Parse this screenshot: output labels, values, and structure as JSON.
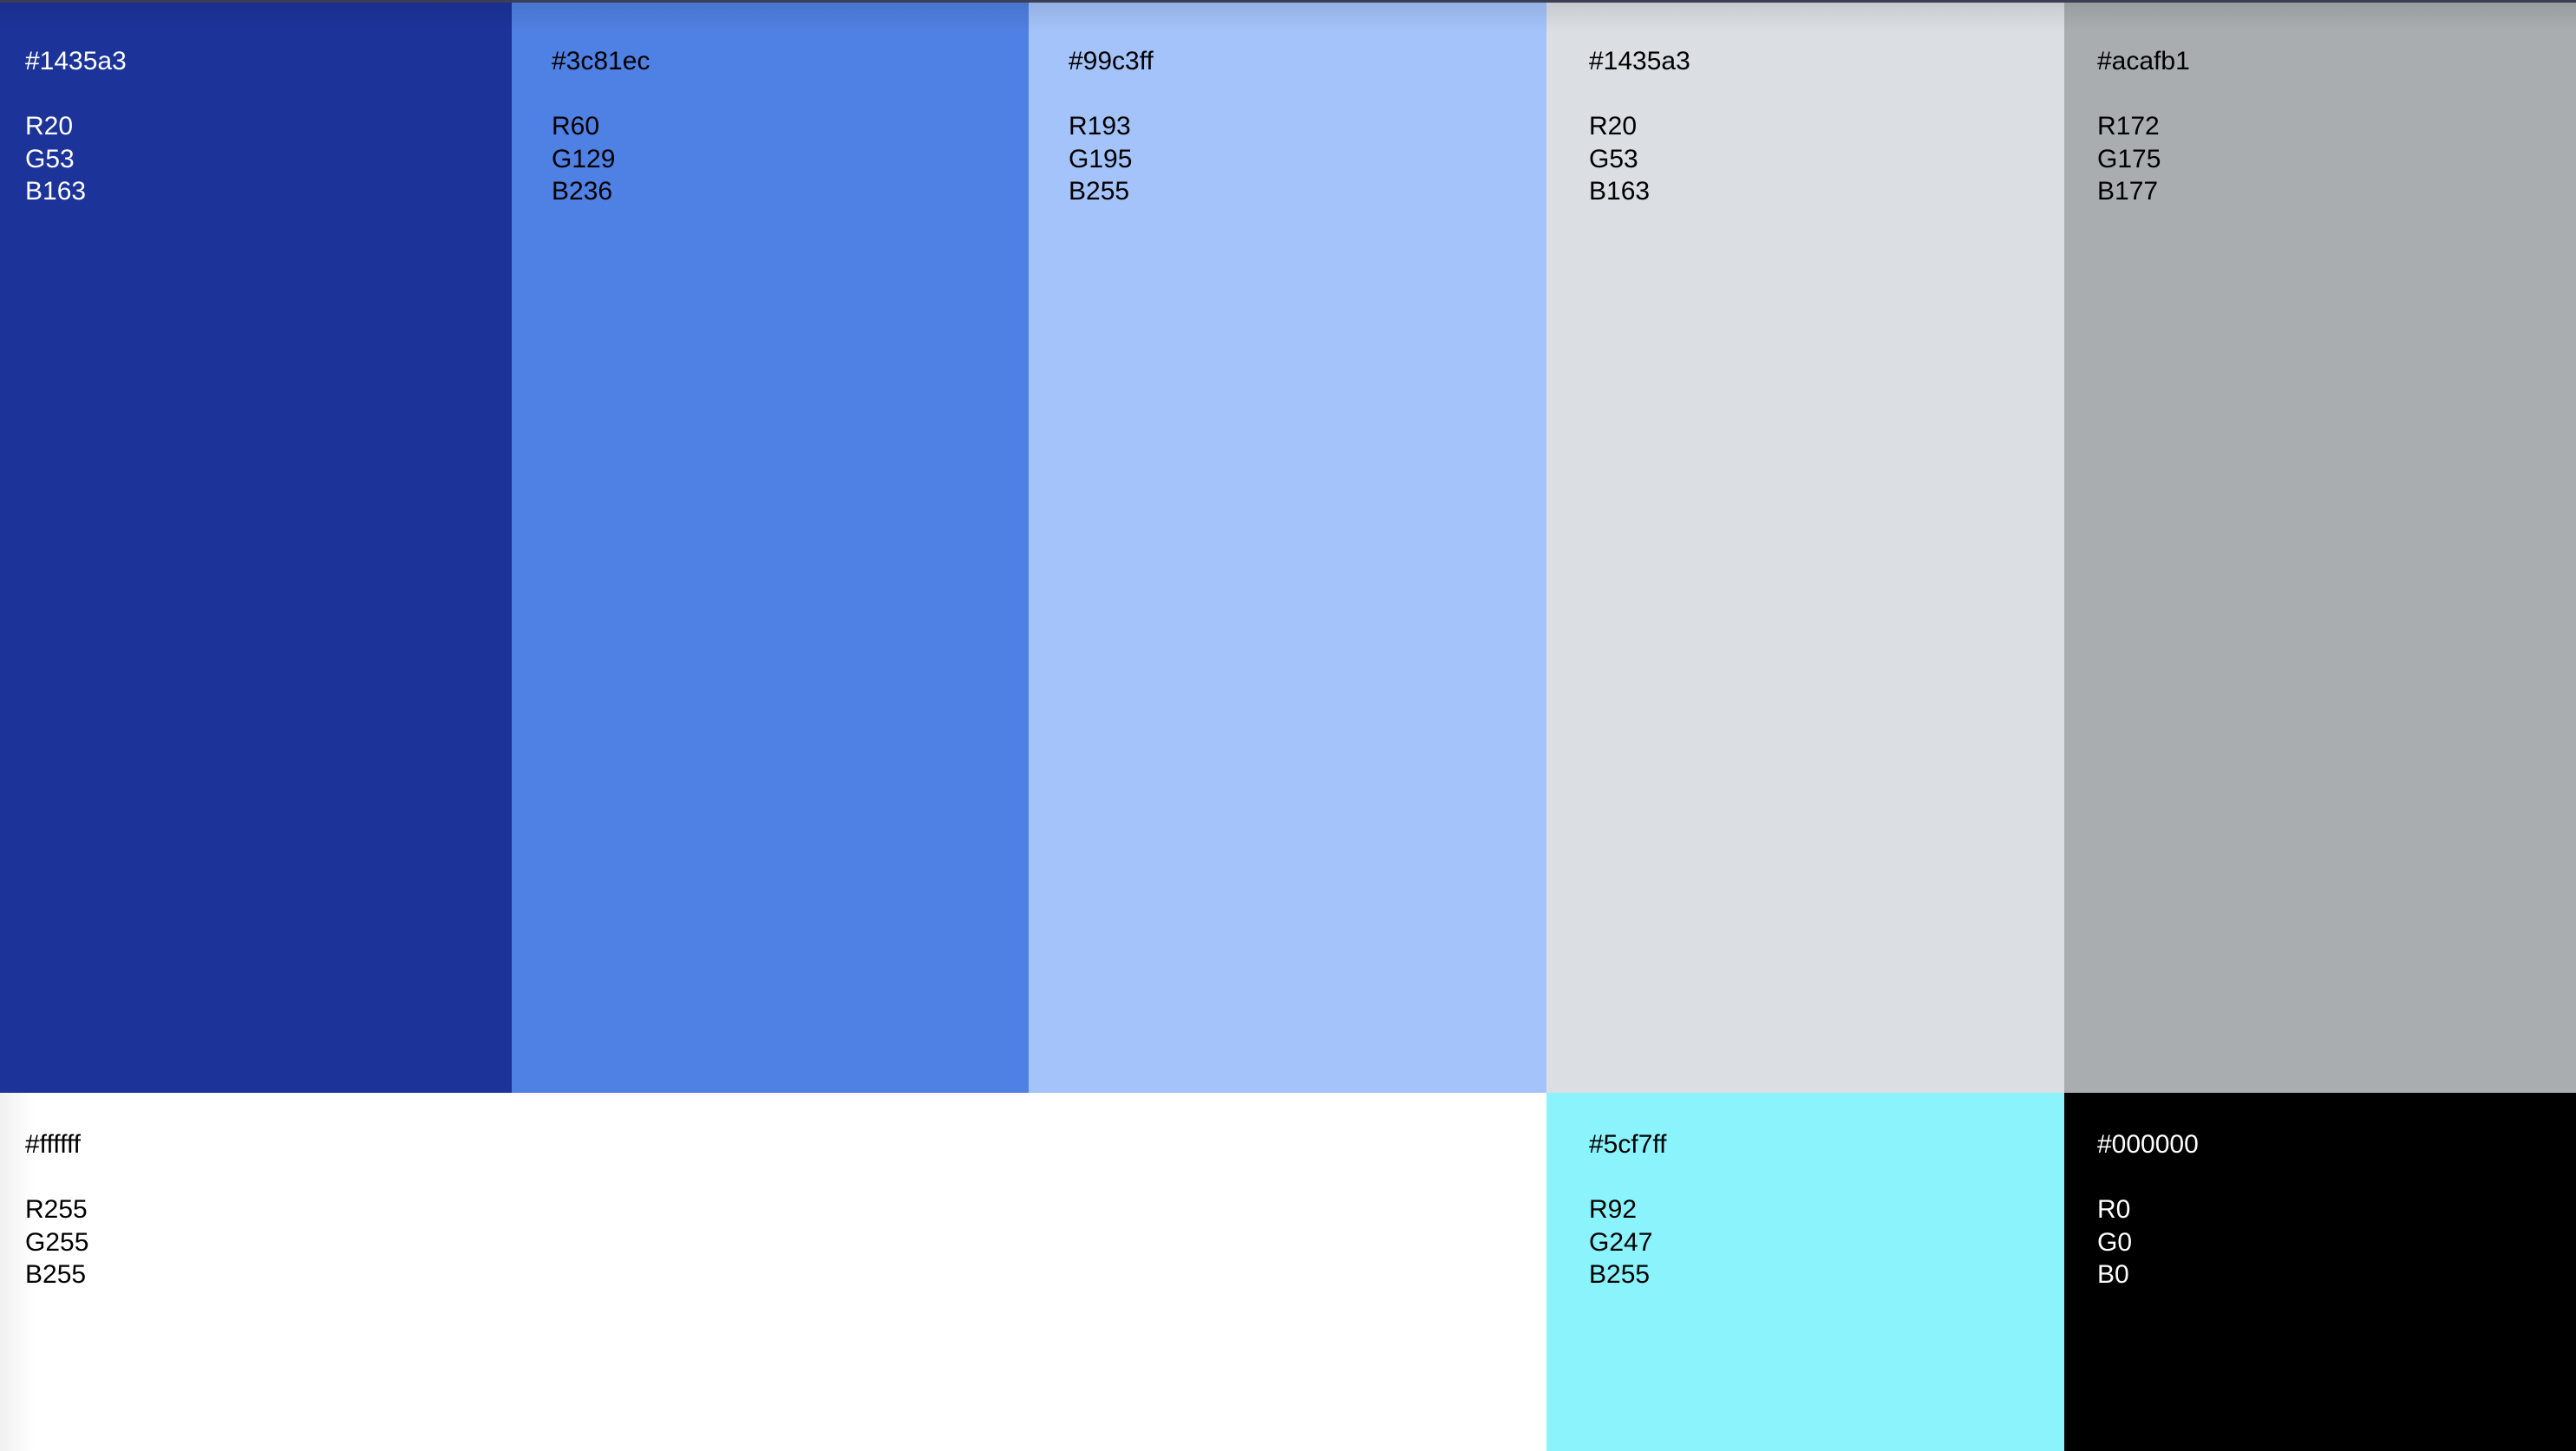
{
  "swatches": [
    {
      "hex": "#1435a3",
      "r": "R20",
      "g": "G53",
      "b": "B163",
      "fill": "#1c339a",
      "text_color": "#ffffff"
    },
    {
      "hex": "#3c81ec",
      "r": "R60",
      "g": "G129",
      "b": "B236",
      "fill": "#4f80e3",
      "text_color": "#000000"
    },
    {
      "hex": "#99c3ff",
      "r": "R193",
      "g": "G195",
      "b": "B255",
      "fill": "#a3c3fa",
      "text_color": "#000000"
    },
    {
      "hex": "#1435a3",
      "r": "R20",
      "g": "G53",
      "b": "B163",
      "fill": "#dbdee3",
      "text_color": "#000000"
    },
    {
      "hex": "#acafb1",
      "r": "R172",
      "g": "G175",
      "b": "B177",
      "fill": "#aaadb0",
      "text_color": "#000000"
    },
    {
      "hex": "#ffffff",
      "r": "R255",
      "g": "G255",
      "b": "B255",
      "fill": "#ffffff",
      "text_color": "#000000"
    },
    {
      "hex": "#5cf7ff",
      "r": "R92",
      "g": "G247",
      "b": "B255",
      "fill": "#8af3fc",
      "text_color": "#000000"
    },
    {
      "hex": "#000000",
      "r": "R0",
      "g": "G0",
      "b": "B0",
      "fill": "#000000",
      "text_color": "#ffffff"
    }
  ]
}
